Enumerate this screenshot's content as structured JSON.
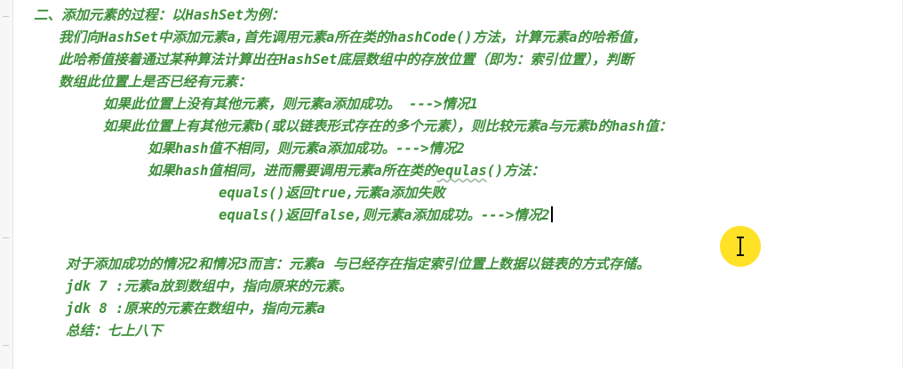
{
  "lines": [
    "二、添加元素的过程：以HashSet为例：",
    "我们向HashSet中添加元素a,首先调用元素a所在类的hashCode()方法，计算元素a的哈希值，",
    "此哈希值接着通过某种算法计算出在HashSet底层数组中的存放位置（即为：索引位置），判断",
    "数组此位置上是否已经有元素：",
    "如果此位置上没有其他元素，则元素a添加成功。 --->情况1",
    "如果此位置上有其他元素b(或以链表形式存在的多个元素），则比较元素a与元素b的hash值：",
    "如果hash值不相同，则元素a添加成功。--->情况2",
    "如果hash值相同，进而需要调用元素a所在类的equlas()方法：",
    "equals()返回true,元素a添加失败",
    "equals()返回false,则元素a添加成功。--->情况2",
    "对于添加成功的情况2和情况3而言：元素a 与已经存在指定索引位置上数据以链表的方式存储。",
    "jdk 7 :元素a放到数组中，指向原来的元素。",
    "jdk 8 :原来的元素在数组中，指向元素a",
    "总结：七上八下"
  ],
  "line8_parts": {
    "before": "如果hash值相同，进而需要调用元素a所在类的",
    "squiggle": "equlas",
    "after": "()方法："
  },
  "colors": {
    "comment_text": "#3d8f3a",
    "cursor_highlight": "#ffdc00",
    "background": "#ffffff"
  }
}
